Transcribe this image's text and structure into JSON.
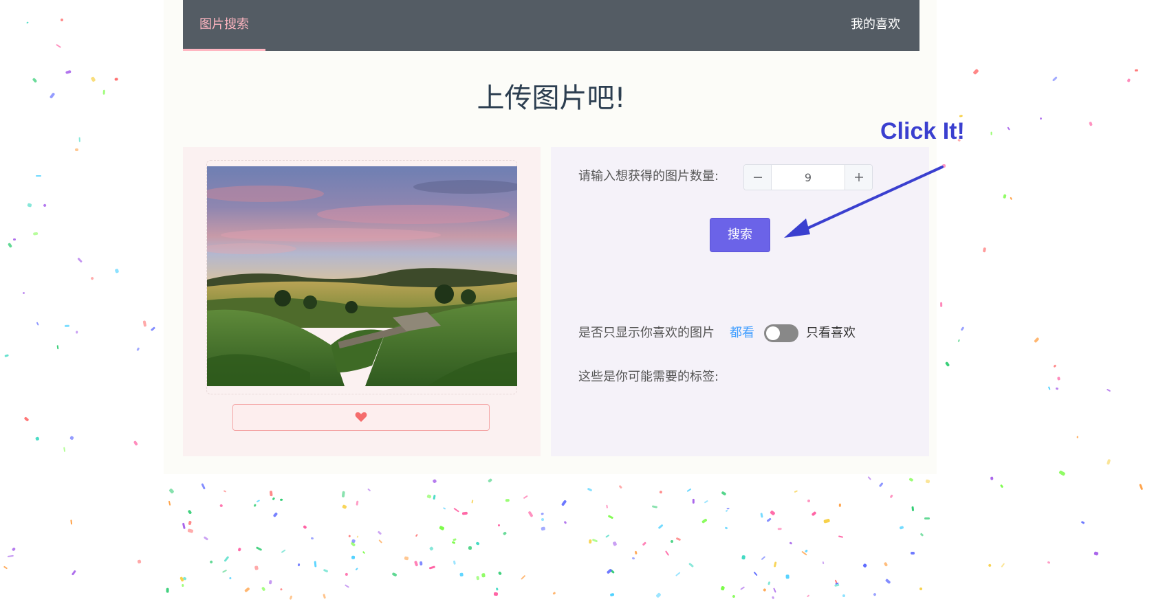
{
  "nav": {
    "search_tab": "图片搜索",
    "favorites_tab": "我的喜欢",
    "active_color": "#ffb6c1"
  },
  "page": {
    "title": "上传图片吧!"
  },
  "image_panel": {
    "like_icon": "heart-icon",
    "like_color": "#f56c6c"
  },
  "search_panel": {
    "count_label": "请输入想获得的图片数量:",
    "count_value": "9",
    "search_button": "搜索",
    "favorites_label": "是否只显示你喜欢的图片",
    "toggle_off_label": "都看",
    "toggle_on_label": "只看喜欢",
    "toggle_on": false,
    "tags_label": "这些是你可能需要的标签:"
  },
  "annotation": {
    "text": "Click It!",
    "color": "#3a3fcf"
  },
  "colors": {
    "primary_button": "#6b63e8",
    "navbar": "#545c64"
  }
}
